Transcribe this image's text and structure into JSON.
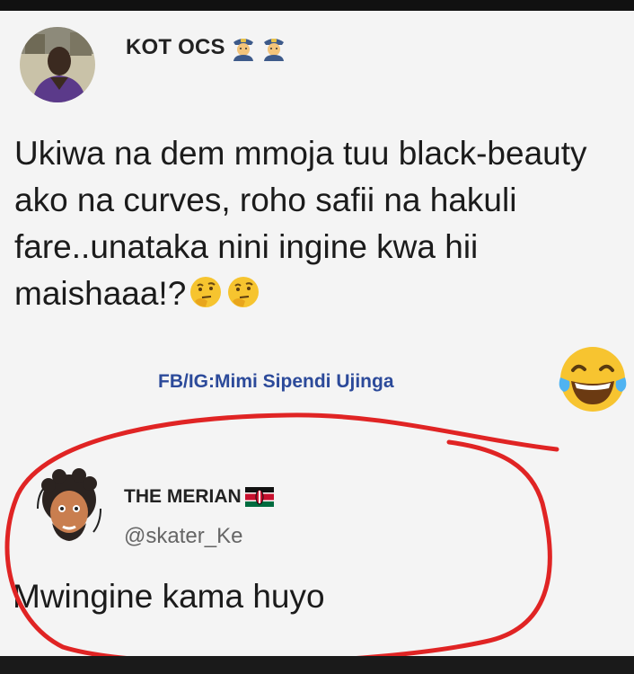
{
  "tweet_1": {
    "author_name": "KOT OCS",
    "author_emojis": [
      "police-officer-icon",
      "police-officer-icon"
    ],
    "body": "Ukiwa na dem mmoja tuu black-beauty ako na curves, roho safii na hakuli fare..unataka nini ingine kwa hii maishaaa!?",
    "body_emojis": [
      "thinking-face-icon",
      "thinking-face-icon"
    ]
  },
  "watermark": "FB/IG:Mimi Sipendi Ujinga",
  "reaction_emoji": "face-with-tears-of-joy-icon",
  "tweet_2": {
    "author_name": "THE MERIAN",
    "author_flag": "kenya-flag-icon",
    "handle": "@skater_Ke",
    "body": "Mwingine kama huyo"
  },
  "colors": {
    "annotation": "#e02424",
    "watermark": "#2c4a9a",
    "handle": "#666666"
  }
}
